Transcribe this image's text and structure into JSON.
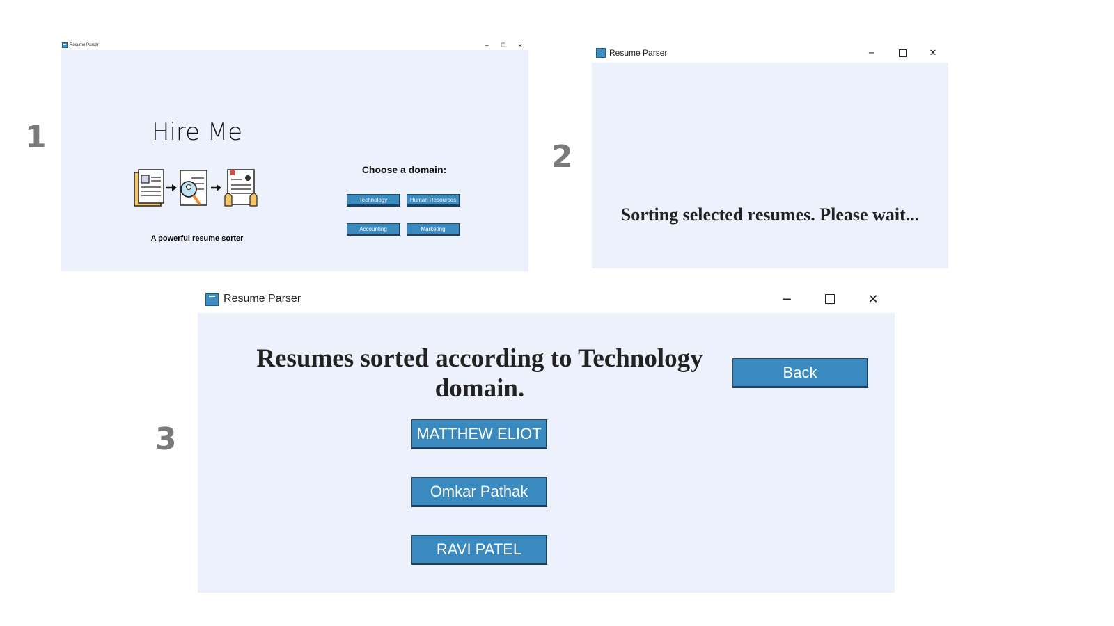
{
  "steps": {
    "one": "1",
    "two": "2",
    "three": "3"
  },
  "window_title": "Resume Parser",
  "screen1": {
    "app_name": "Hire Me",
    "tagline": "A powerful resume sorter",
    "choose_label": "Choose a domain:",
    "domains": [
      "Technology",
      "Human Resources",
      "Accounting",
      "Marketing"
    ]
  },
  "screen2": {
    "status": "Sorting selected resumes. Please wait..."
  },
  "screen3": {
    "heading": "Resumes sorted according to Technology domain.",
    "back_label": "Back",
    "candidates": [
      "MATTHEW ELIOT",
      "Omkar Pathak",
      "RAVI PATEL"
    ]
  },
  "colors": {
    "button": "#3a8ac0",
    "client_bg": "#edf1fc",
    "step_number": "#7a7a7a"
  },
  "icons": [
    "app-icon",
    "minimize-icon",
    "maximize-icon",
    "close-icon",
    "resume-document-icon",
    "magnifier-icon",
    "candidate-profile-icon",
    "arrow-right-icon"
  ]
}
